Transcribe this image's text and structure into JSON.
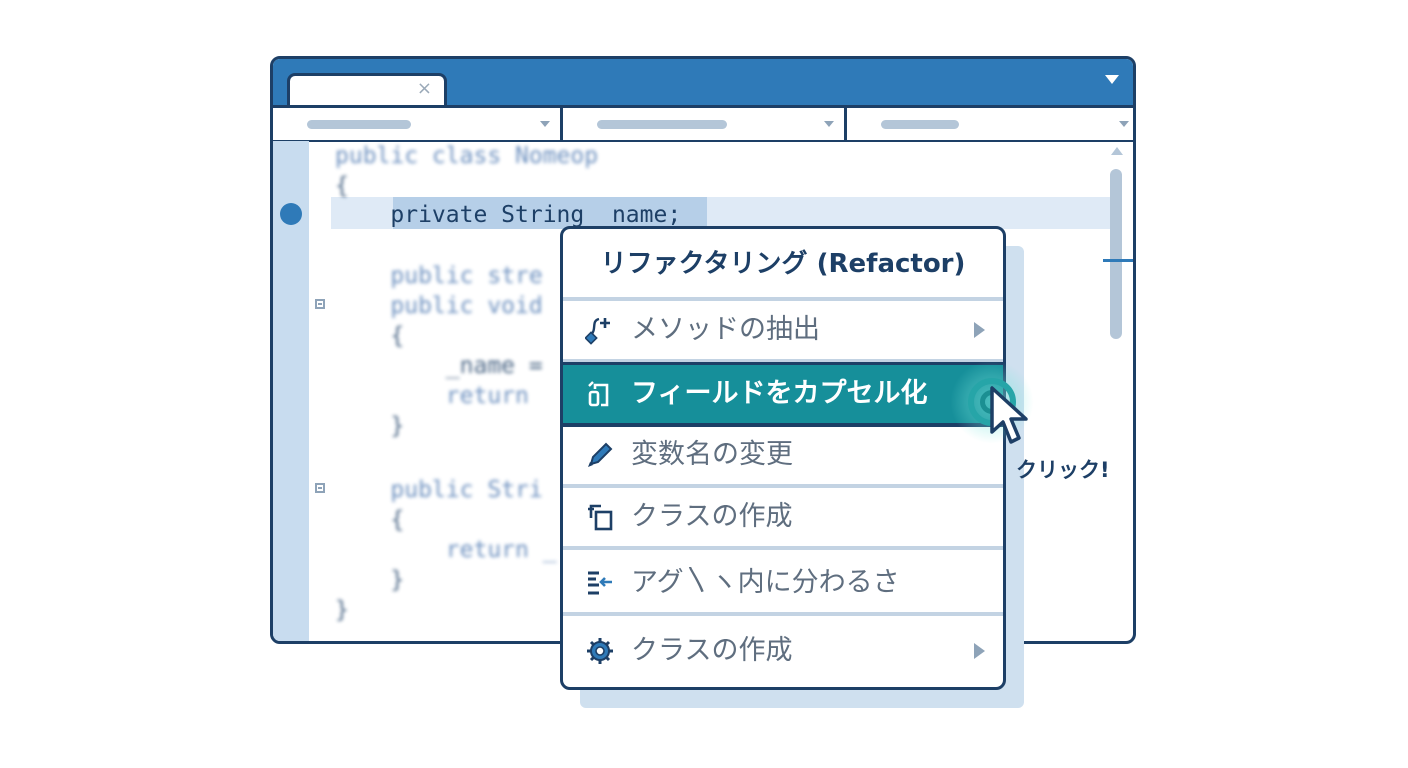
{
  "editor": {
    "tab_close": "×",
    "code_lines": [
      "public class Nomeop",
      "{",
      "    private String _name;",
      "    public stre",
      "    public void",
      "    {",
      "        _name =",
      "        return",
      "    }",
      "    public Stri",
      "    {",
      "        return _",
      "    }",
      "}"
    ]
  },
  "context_menu": {
    "title": "リファクタリング (Refactor)",
    "items": [
      {
        "label": "メソッドの抽出",
        "icon": "extract-method-icon",
        "has_submenu": true
      },
      {
        "label": "フィールドをカプセル化",
        "icon": "encapsulate-field-icon",
        "has_submenu": false,
        "active": true
      },
      {
        "label": "変数名の変更",
        "icon": "pencil-icon",
        "has_submenu": false
      },
      {
        "label": "クラスの作成",
        "icon": "create-class-icon",
        "has_submenu": false
      },
      {
        "label": "アグ〵ヽ内に分わるさ",
        "icon": "reorder-lines-icon",
        "has_submenu": false
      },
      {
        "label": "クラスの作成",
        "icon": "gear-icon",
        "has_submenu": true
      }
    ]
  },
  "annotation": {
    "click_label": "クリック!"
  },
  "colors": {
    "frame": "#1d3f66",
    "accent": "#2f7ab8",
    "highlight": "#168f9a"
  }
}
